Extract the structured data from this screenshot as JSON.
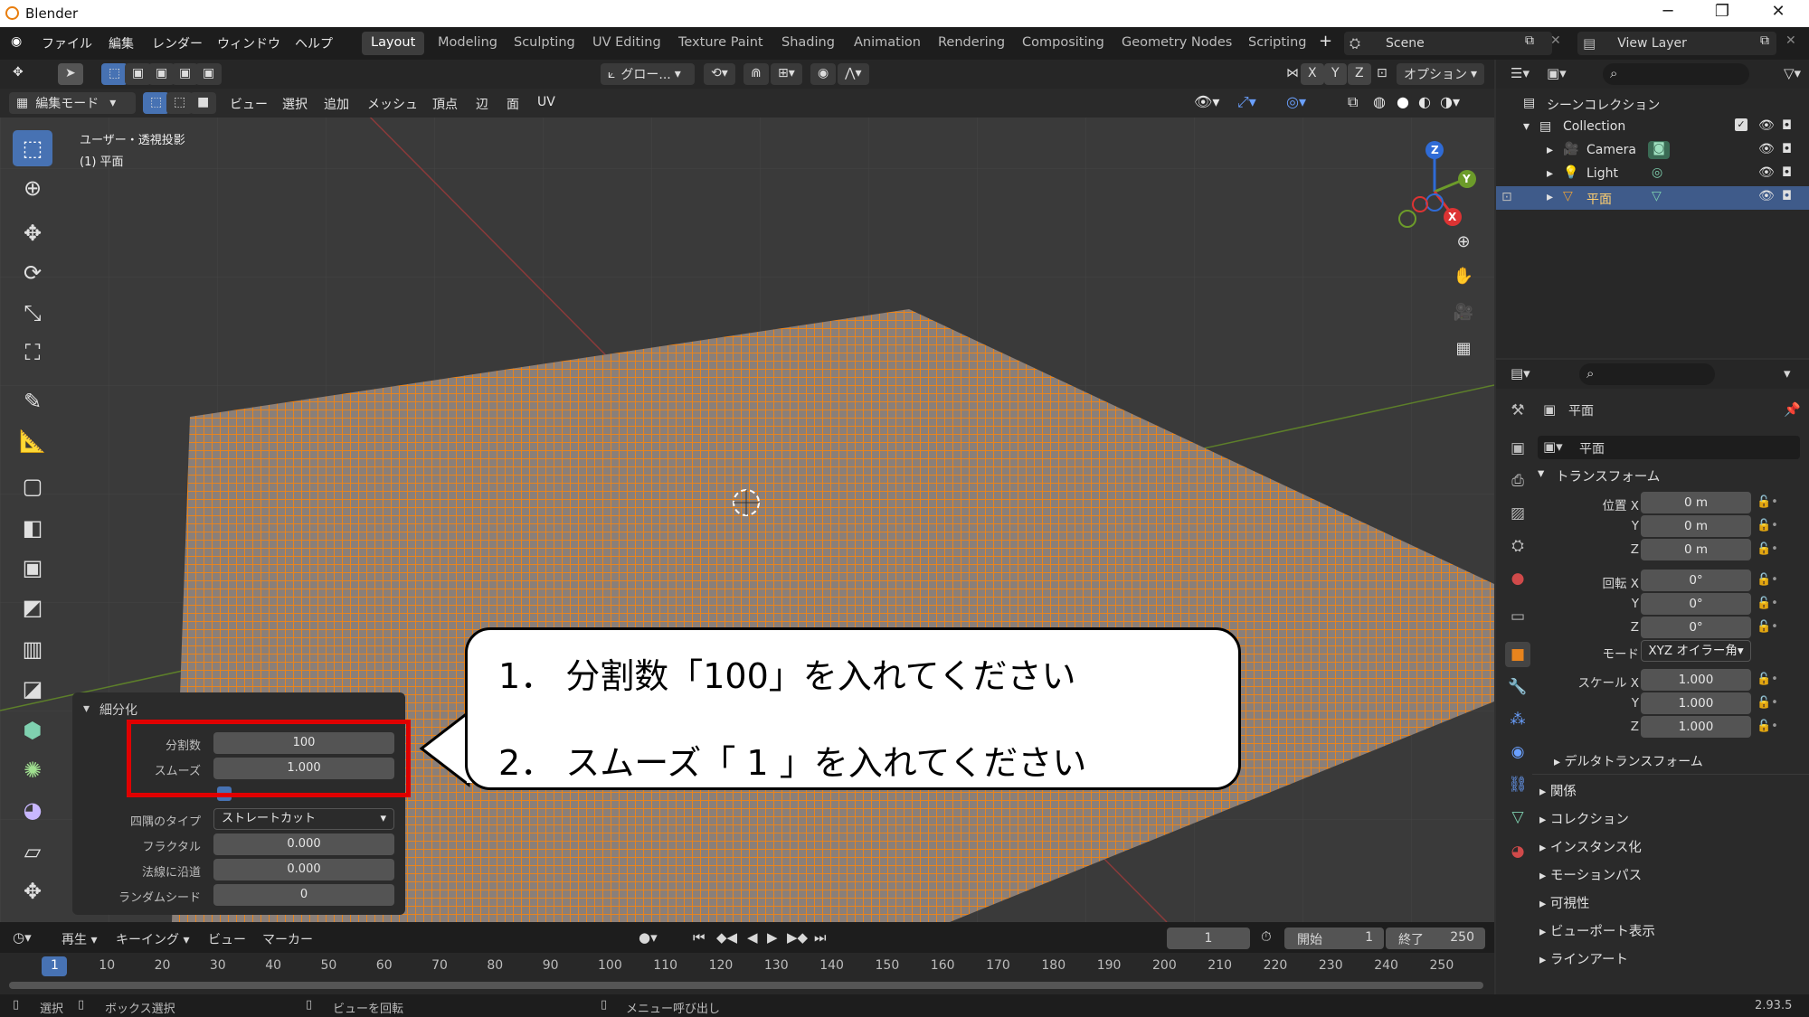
{
  "app_title": "Blender",
  "menus": [
    "ファイル",
    "編集",
    "レンダー",
    "ウィンドウ",
    "ヘルプ"
  ],
  "workspaces": [
    "Layout",
    "Modeling",
    "Sculpting",
    "UV Editing",
    "Texture Paint",
    "Shading",
    "Animation",
    "Rendering",
    "Compositing",
    "Geometry Nodes",
    "Scripting"
  ],
  "scene_name": "Scene",
  "view_layer": "View Layer",
  "viewport": {
    "transform_orientation": "グロー...",
    "options_label": "オプション",
    "axes": [
      "X",
      "Y",
      "Z"
    ],
    "mode": "編集モード",
    "header_menus": [
      "ビュー",
      "選択",
      "追加",
      "メッシュ",
      "頂点",
      "辺",
      "面",
      "UV"
    ],
    "view_title": "ユーザー・透視投影",
    "object_label": "(1) 平面",
    "gizmo": {
      "x": "X",
      "y": "Y",
      "z": "Z"
    }
  },
  "operator_panel": {
    "title": "細分化",
    "fields": [
      {
        "label": "分割数",
        "value": "100"
      },
      {
        "label": "スムーズ",
        "value": "1.000"
      }
    ],
    "corner_type_label": "四隅のタイプ",
    "corner_type_value": "ストレートカット",
    "fields2": [
      {
        "label": "フラクタル",
        "value": "0.000"
      },
      {
        "label": "法線に沿道",
        "value": "0.000"
      },
      {
        "label": "ランダムシード",
        "value": "0"
      }
    ]
  },
  "callout": {
    "line1": "1． 分割数「100」を入れてください",
    "line2": "2． スムーズ「 1 」を入れてください"
  },
  "outliner": {
    "root": "シーンコレクション",
    "collection": "Collection",
    "items": [
      "Camera",
      "Light",
      "平面"
    ]
  },
  "properties": {
    "object_name": "平面",
    "object_field": "平面",
    "transform_title": "トランスフォーム",
    "location": {
      "label": "位置 X",
      "x": "0 m",
      "y": "0 m",
      "z": "0 m"
    },
    "rotation": {
      "label": "回転 X",
      "x": "0°",
      "y": "0°",
      "z": "0°"
    },
    "mode_label": "モード",
    "mode_value": "XYZ オイラー角",
    "scale": {
      "label": "スケール X",
      "x": "1.000",
      "y": "1.000",
      "z": "1.000"
    },
    "axis_y": "Y",
    "axis_z": "Z",
    "delta_transform": "デルタトランスフォーム",
    "sections": [
      "関係",
      "コレクション",
      "インスタンス化",
      "モーションパス",
      "可視性",
      "ビューポート表示",
      "ラインアート"
    ]
  },
  "timeline": {
    "menus": [
      "再生",
      "キーイング",
      "ビュー",
      "マーカー"
    ],
    "current_frame": "1",
    "start_label": "開始",
    "start": "1",
    "end_label": "終了",
    "end": "250",
    "ticks": [
      "1",
      "10",
      "20",
      "30",
      "40",
      "50",
      "60",
      "70",
      "80",
      "90",
      "100",
      "110",
      "120",
      "130",
      "140",
      "150",
      "160",
      "170",
      "180",
      "190",
      "200",
      "210",
      "220",
      "230",
      "240",
      "250"
    ]
  },
  "statusbar": {
    "items": [
      "選択",
      "ボックス選択",
      "ビューを回転",
      "メニュー呼び出し"
    ],
    "version": "2.93.5"
  }
}
